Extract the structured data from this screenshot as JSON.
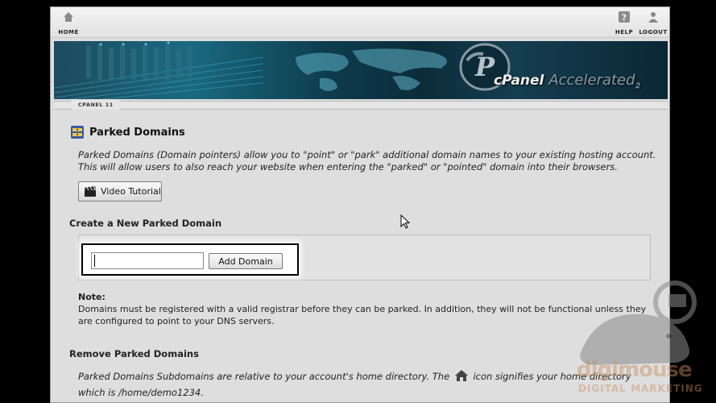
{
  "toolbar": {
    "home_label": "HOME",
    "help_label": "HELP",
    "logout_label": "LOGOUT"
  },
  "banner": {
    "logo_c": "cPanel",
    "logo_accel": "Accelerated",
    "logo_version": "2"
  },
  "version_tab": "CPANEL 11",
  "page": {
    "title": "Parked Domains",
    "description": "Parked Domains (Domain pointers) allow you to \"point\" or \"park\" additional domain names to your existing hosting account. This will allow users to also reach your website when entering the \"parked\" or \"pointed\" domain into their browsers.",
    "video_button": "Video Tutorial"
  },
  "create": {
    "title": "Create a New Parked Domain",
    "input_value": "",
    "add_button": "Add Domain"
  },
  "note": {
    "label": "Note:",
    "text": "Domains must be registered with a valid registrar before they can be parked. In addition, they will not be functional unless they are configured to point to your DNS servers."
  },
  "remove": {
    "title": "Remove Parked Domains",
    "desc_before": "Parked Domains Subdomains are relative to your account's home directory. The",
    "desc_after": "icon signifies your home directory which is /home/demo1234."
  },
  "watermark": {
    "brand": "digimouse",
    "sub": "DIGITAL MARKETING"
  },
  "colors": {
    "banner_dark": "#0c2c3a",
    "banner_teal": "#1a6a80",
    "frame_bg": "#dedede",
    "highlight_border": "#000000"
  }
}
